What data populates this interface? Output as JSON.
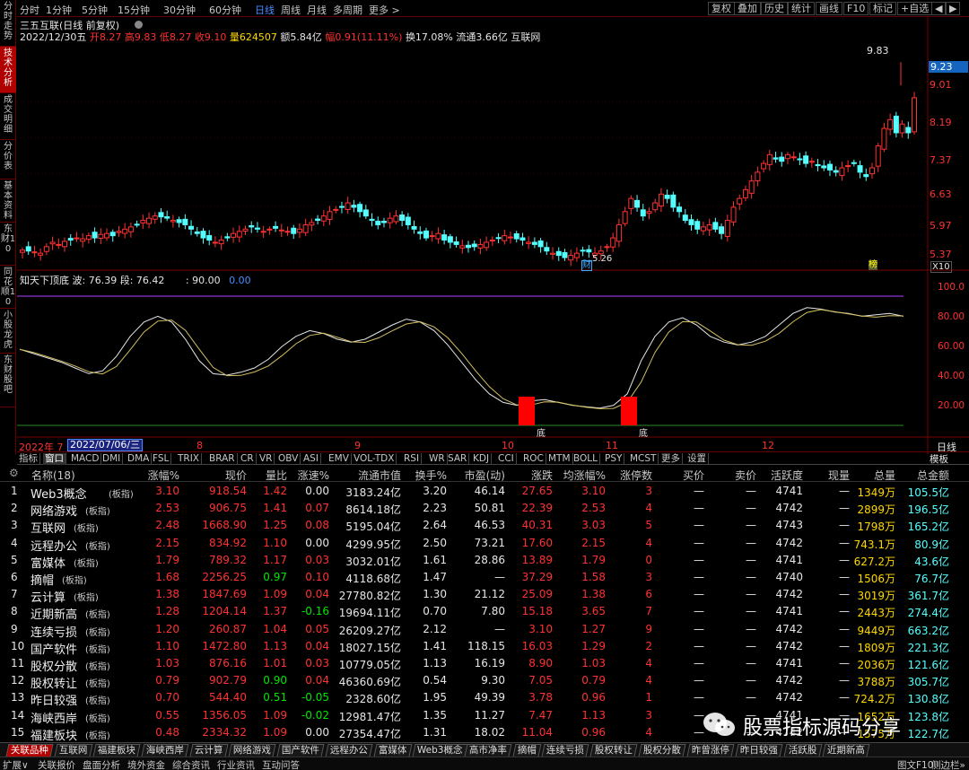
{
  "sidebar": [
    "分时走势",
    "技术分析",
    "成交明细",
    "分价表",
    "基本资料",
    "东财10",
    "同花顺10",
    "小股龙虎",
    "东财股吧"
  ],
  "topbar": {
    "periods": [
      "分时",
      "1分钟",
      "5分钟",
      "15分钟",
      "30分钟",
      "60分钟",
      "日线",
      "周线",
      "月线",
      "多周期",
      "更多 >"
    ],
    "active_period": "日线",
    "tools": [
      "复权",
      "叠加",
      "历史",
      "统计",
      "画线",
      "F10",
      "标记",
      "+自选",
      "◀",
      "▶"
    ]
  },
  "chart_header": {
    "title": "三五互联(日线 前复权)",
    "date": "2022/12/30五",
    "open_label": "开",
    "open": "8.27",
    "high_label": "高",
    "high": "9.83",
    "low_label": "低",
    "low": "8.27",
    "close_label": "收",
    "close": "9.10",
    "vol_label": "量",
    "vol": "624507",
    "amt_label": "额",
    "amt": "5.84亿",
    "chg_label": "幅",
    "chg": "0.91(11.11%)",
    "turn": "换17.08%",
    "float": "流通3.66亿",
    "concept": "互联网"
  },
  "price_axis": [
    "9.01",
    "8.19",
    "7.37",
    "6.63",
    "5.97",
    "5.37"
  ],
  "current_price_tag": "9.23",
  "hi_label": "9.83",
  "lo_label": "5.26",
  "cai_label": "财",
  "bang_label": "榜",
  "x10": "X10",
  "indicator": {
    "name": "知天下顶底",
    "params": "波: 76.39  段: 76.42",
    "v1": ": 90.00",
    "v2": "0.00",
    "axis": [
      "100.0",
      "80.00",
      "60.00",
      "40.00",
      "20.00"
    ],
    "di": "底"
  },
  "date_axis": {
    "start": "2022年 7",
    "cursor": "2022/07/06/三",
    "ticks": [
      "8",
      "9",
      "10",
      "11",
      "12"
    ],
    "right": "日线"
  },
  "indicator_tabs": [
    "指标",
    "窗口",
    "MACD",
    "DMI",
    "DMA",
    "FSL",
    "TRIX",
    "BRAR",
    "CR",
    "VR",
    "OBV",
    "ASI",
    "EMV",
    "VOL-TDX",
    "RSI",
    "WR",
    "SAR",
    "KDJ",
    "CCI",
    "ROC",
    "MTM",
    "BOLL",
    "PSY",
    "MCST",
    "更多",
    "设置"
  ],
  "template_label": "模板",
  "table": {
    "headers": [
      "名称(18)",
      "涨幅%",
      "现价",
      "量比",
      "涨速%",
      "流通市值",
      "换手%",
      "市盈(动)",
      "涨跌",
      "均涨幅%",
      "涨停数",
      "买价",
      "卖价",
      "活跃度",
      "现量",
      "总量",
      "总金额"
    ],
    "rows": [
      {
        "no": "1",
        "name": "Web3概念",
        "tag": "(板指)",
        "chg": "3.10",
        "price": "918.54",
        "lb": "1.42",
        "spd": "0.00",
        "mcap": "3183.24亿",
        "turn": "3.20",
        "pe": "46.14",
        "diff": "27.65",
        "avg": "3.10",
        "zt": "3",
        "buy": "—",
        "sell": "—",
        "act": "4741",
        "cur": "—",
        "vol": "1349万",
        "amt": "105.5亿"
      },
      {
        "no": "2",
        "name": "网络游戏",
        "tag": "(板指)",
        "chg": "2.53",
        "price": "906.75",
        "lb": "1.41",
        "spd": "0.07",
        "mcap": "8614.18亿",
        "turn": "2.23",
        "pe": "50.81",
        "diff": "22.39",
        "avg": "2.53",
        "zt": "4",
        "buy": "—",
        "sell": "—",
        "act": "4742",
        "cur": "—",
        "vol": "2899万",
        "amt": "196.5亿"
      },
      {
        "no": "3",
        "name": "互联网",
        "tag": "(板指)",
        "chg": "2.48",
        "price": "1668.90",
        "lb": "1.25",
        "spd": "0.08",
        "mcap": "5195.04亿",
        "turn": "2.64",
        "pe": "46.53",
        "diff": "40.31",
        "avg": "3.03",
        "zt": "5",
        "buy": "—",
        "sell": "—",
        "act": "4743",
        "cur": "—",
        "vol": "1798万",
        "amt": "165.2亿"
      },
      {
        "no": "4",
        "name": "远程办公",
        "tag": "(板指)",
        "chg": "2.15",
        "price": "834.92",
        "lb": "1.10",
        "spd": "0.00",
        "mcap": "4299.95亿",
        "turn": "2.50",
        "pe": "73.21",
        "diff": "17.60",
        "avg": "2.15",
        "zt": "4",
        "buy": "—",
        "sell": "—",
        "act": "4742",
        "cur": "—",
        "vol": "743.1万",
        "amt": "80.9亿"
      },
      {
        "no": "5",
        "name": "富媒体",
        "tag": "(板指)",
        "chg": "1.79",
        "price": "789.32",
        "lb": "1.17",
        "spd": "0.03",
        "mcap": "3032.01亿",
        "turn": "1.61",
        "pe": "28.86",
        "diff": "13.89",
        "avg": "1.79",
        "zt": "0",
        "buy": "—",
        "sell": "—",
        "act": "4741",
        "cur": "—",
        "vol": "627.2万",
        "amt": "43.6亿"
      },
      {
        "no": "6",
        "name": "摘帽",
        "tag": "(板指)",
        "chg": "1.68",
        "price": "2256.25",
        "lb": "0.97",
        "spd": "0.10",
        "mcap": "4118.68亿",
        "turn": "1.47",
        "pe": "—",
        "diff": "37.29",
        "avg": "1.58",
        "zt": "3",
        "buy": "—",
        "sell": "—",
        "act": "4740",
        "cur": "—",
        "vol": "1506万",
        "amt": "76.7亿"
      },
      {
        "no": "7",
        "name": "云计算",
        "tag": "(板指)",
        "chg": "1.38",
        "price": "1847.69",
        "lb": "1.09",
        "spd": "0.04",
        "mcap": "27780.82亿",
        "turn": "1.30",
        "pe": "21.12",
        "diff": "25.09",
        "avg": "1.38",
        "zt": "6",
        "buy": "—",
        "sell": "—",
        "act": "4742",
        "cur": "—",
        "vol": "3019万",
        "amt": "361.7亿"
      },
      {
        "no": "8",
        "name": "近期新高",
        "tag": "(板指)",
        "chg": "1.28",
        "price": "1204.14",
        "lb": "1.37",
        "spd": "-0.16",
        "mcap": "19694.11亿",
        "turn": "0.70",
        "pe": "7.80",
        "diff": "15.18",
        "avg": "3.65",
        "zt": "7",
        "buy": "—",
        "sell": "—",
        "act": "4741",
        "cur": "—",
        "vol": "2443万",
        "amt": "274.4亿"
      },
      {
        "no": "9",
        "name": "连续亏损",
        "tag": "(板指)",
        "chg": "1.20",
        "price": "260.87",
        "lb": "1.04",
        "spd": "0.05",
        "mcap": "26209.27亿",
        "turn": "2.12",
        "pe": "—",
        "diff": "3.10",
        "avg": "1.27",
        "zt": "9",
        "buy": "—",
        "sell": "—",
        "act": "4742",
        "cur": "—",
        "vol": "9449万",
        "amt": "663.2亿"
      },
      {
        "no": "10",
        "name": "国产软件",
        "tag": "(板指)",
        "chg": "1.10",
        "price": "1472.80",
        "lb": "1.13",
        "spd": "0.04",
        "mcap": "18027.15亿",
        "turn": "1.41",
        "pe": "118.15",
        "diff": "16.03",
        "avg": "1.29",
        "zt": "2",
        "buy": "—",
        "sell": "—",
        "act": "4742",
        "cur": "—",
        "vol": "1809万",
        "amt": "221.3亿"
      },
      {
        "no": "11",
        "name": "股权分散",
        "tag": "(板指)",
        "chg": "1.03",
        "price": "876.16",
        "lb": "1.01",
        "spd": "0.03",
        "mcap": "10779.05亿",
        "turn": "1.13",
        "pe": "16.19",
        "diff": "8.90",
        "avg": "1.03",
        "zt": "4",
        "buy": "—",
        "sell": "—",
        "act": "4741",
        "cur": "—",
        "vol": "2036万",
        "amt": "121.6亿"
      },
      {
        "no": "12",
        "name": "股权转让",
        "tag": "(板指)",
        "chg": "0.79",
        "price": "902.79",
        "lb": "0.90",
        "spd": "0.04",
        "mcap": "46360.69亿",
        "turn": "0.54",
        "pe": "9.30",
        "diff": "7.05",
        "avg": "0.79",
        "zt": "4",
        "buy": "—",
        "sell": "—",
        "act": "4742",
        "cur": "—",
        "vol": "3788万",
        "amt": "305.7亿"
      },
      {
        "no": "13",
        "name": "昨日较强",
        "tag": "(板指)",
        "chg": "0.70",
        "price": "544.40",
        "lb": "0.51",
        "spd": "-0.05",
        "mcap": "2328.60亿",
        "turn": "1.95",
        "pe": "49.39",
        "diff": "3.78",
        "avg": "0.96",
        "zt": "1",
        "buy": "—",
        "sell": "—",
        "act": "4742",
        "cur": "—",
        "vol": "724.2万",
        "amt": "130.8亿"
      },
      {
        "no": "14",
        "name": "海峡西岸",
        "tag": "(板指)",
        "chg": "0.55",
        "price": "1356.05",
        "lb": "1.09",
        "spd": "-0.02",
        "mcap": "12981.47亿",
        "turn": "1.35",
        "pe": "11.27",
        "diff": "7.47",
        "avg": "1.13",
        "zt": "3",
        "buy": "—",
        "sell": "—",
        "act": "4741",
        "cur": "—",
        "vol": "1652万",
        "amt": "123.8亿"
      },
      {
        "no": "15",
        "name": "福建板块",
        "tag": "(板指)",
        "chg": "0.48",
        "price": "2334.32",
        "lb": "1.09",
        "spd": "0.00",
        "mcap": "27354.47亿",
        "turn": "1.31",
        "pe": "18.02",
        "diff": "11.04",
        "avg": "0.96",
        "zt": "4",
        "buy": "—",
        "sell": "—",
        "act": "4742",
        "cur": "—",
        "vol": "1575万",
        "amt": "122.7亿"
      }
    ]
  },
  "bottom_tabs": [
    "关联品种",
    "互联网",
    "福建板块",
    "海峡西岸",
    "云计算",
    "网络游戏",
    "国产软件",
    "远程办公",
    "富媒体",
    "Web3概念",
    "高市净率",
    "摘帽",
    "连续亏损",
    "股权转让",
    "股权分散",
    "昨曾涨停",
    "昨日较强",
    "活跃股",
    "近期新高"
  ],
  "status_bar": [
    "扩展∨",
    "关联报价",
    "盘面分析",
    "境外资金",
    "综合资讯",
    "行业资讯",
    "互动问答"
  ],
  "status_right": "图文F10",
  "status_right2": "侧边栏»",
  "watermark": "股票指标源码分享",
  "colors": {
    "up": "#ff3232",
    "down": "#00e600",
    "candle_up": "#ff3232",
    "candle_down": "#54ffff",
    "accent": "#4a8cff"
  }
}
